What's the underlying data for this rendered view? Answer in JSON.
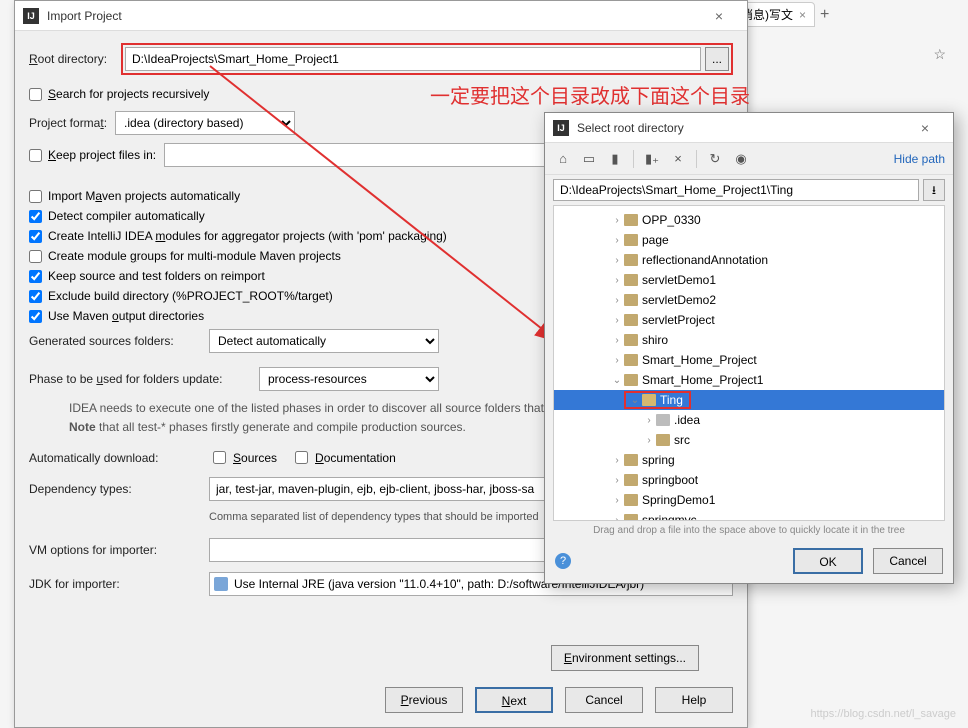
{
  "annotation": "一定要把这个目录改成下面这个目录",
  "browser": {
    "tab_label": "条消息)写文",
    "star": "☆"
  },
  "main": {
    "title": "Import Project",
    "root_label": "Root directory:",
    "root_path": "D:\\IdeaProjects\\Smart_Home_Project1",
    "browse": "...",
    "search_recursive": "Search for projects recursively",
    "project_format_label": "Project format:",
    "project_format_value": ".idea (directory based)",
    "keep_files": "Keep project files in:",
    "import_maven": "Import Maven projects automatically",
    "detect_compiler": "Detect compiler automatically",
    "create_modules": "Create IntelliJ IDEA modules for aggregator projects (with 'pom' packaging)",
    "create_groups": "Create module groups for multi-module Maven projects",
    "keep_source": "Keep source and test folders on reimport",
    "exclude_build": "Exclude build directory (%PROJECT_ROOT%/target)",
    "use_maven_output": "Use Maven output directories",
    "generated_label": "Generated sources folders:",
    "generated_value": "Detect automatically",
    "phase_label": "Phase to be used for folders update:",
    "phase_value": "process-resources",
    "help1": "IDEA needs to execute one of the listed phases in order to discover all source folders that are",
    "help2_note": "Note",
    "help2": " that all test-* phases firstly generate and compile production sources.",
    "auto_download": "Automatically download:",
    "sources": "Sources",
    "documentation": "Documentation",
    "dep_types_label": "Dependency types:",
    "dep_types_value": "jar, test-jar, maven-plugin, ejb, ejb-client, jboss-har, jboss-sa",
    "dep_types_help": "Comma separated list of dependency types that should be imported",
    "vm_label": "VM options for importer:",
    "jdk_label": "JDK for importer:",
    "jdk_value": "Use Internal JRE (java version \"11.0.4+10\", path: D:/software/IntelliJIDEA/jbr)",
    "env_settings": "Environment settings...",
    "btn_prev": "Previous",
    "btn_next": "Next",
    "btn_cancel": "Cancel",
    "btn_help": "Help"
  },
  "sub": {
    "title": "Select root directory",
    "hide_path": "Hide path",
    "path": "D:\\IdeaProjects\\Smart_Home_Project1\\Ting",
    "tree": [
      {
        "name": "OPP_0330",
        "indent": 2,
        "expand": "›"
      },
      {
        "name": "page",
        "indent": 2,
        "expand": "›"
      },
      {
        "name": "reflectionandAnnotation",
        "indent": 2,
        "expand": "›"
      },
      {
        "name": "servletDemo1",
        "indent": 2,
        "expand": "›"
      },
      {
        "name": "servletDemo2",
        "indent": 2,
        "expand": "›"
      },
      {
        "name": "servletProject",
        "indent": 2,
        "expand": "›"
      },
      {
        "name": "shiro",
        "indent": 2,
        "expand": "›"
      },
      {
        "name": "Smart_Home_Project",
        "indent": 2,
        "expand": "›"
      },
      {
        "name": "Smart_Home_Project1",
        "indent": 2,
        "expand": "⌄",
        "expanded": true
      },
      {
        "name": "Ting",
        "indent": 3,
        "expand": "⌄",
        "selected": true,
        "boxed": true
      },
      {
        "name": ".idea",
        "indent": 4,
        "expand": "›",
        "gray": true
      },
      {
        "name": "src",
        "indent": 4,
        "expand": "›"
      },
      {
        "name": "spring",
        "indent": 2,
        "expand": "›"
      },
      {
        "name": "springboot",
        "indent": 2,
        "expand": "›"
      },
      {
        "name": "SpringDemo1",
        "indent": 2,
        "expand": "›"
      },
      {
        "name": "springmvc",
        "indent": 2,
        "expand": "›"
      }
    ],
    "drag_hint": "Drag and drop a file into the space above to quickly locate it in the tree",
    "btn_ok": "OK",
    "btn_cancel": "Cancel"
  },
  "watermark": "https://blog.csdn.net/l_savage"
}
